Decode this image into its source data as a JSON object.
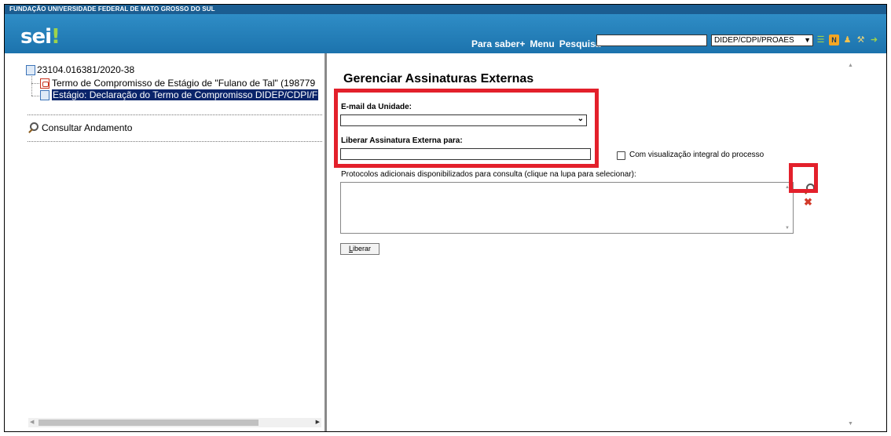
{
  "header": {
    "org_name": "FUNDAÇÃO UNIVERSIDADE FEDERAL DE MATO GROSSO DO SUL",
    "logo_text": "sei",
    "logo_mark": "!",
    "links": [
      "Para saber+",
      "Menu",
      "Pesquisa"
    ],
    "search_value": "",
    "unit_selected": "DIDEP/CDPI/PROAES",
    "icons": [
      "list-icon",
      "notification-icon",
      "user-icon",
      "tools-icon",
      "exit-icon"
    ]
  },
  "tree": {
    "process_number": "23104.016381/2020-38",
    "documents": [
      {
        "label": "Termo de Compromisso de Estágio de \"Fulano de Tal\" (198779",
        "icon": "pdf-icon"
      },
      {
        "label": "Estágio: Declaração do Termo de Compromisso DIDEP/CDPI/F",
        "icon": "document-icon",
        "selected": true
      }
    ],
    "consult_label": "Consultar Andamento"
  },
  "form": {
    "title": "Gerenciar Assinaturas Externas",
    "email_label": "E-mail da Unidade:",
    "email_value": "",
    "liberar_para_label": "Liberar Assinatura Externa para:",
    "liberar_para_value": "",
    "integral_label": "Com visualização integral do processo",
    "protocols_label": "Protocolos adicionais disponibilizados para consulta (clique na lupa para selecionar):",
    "submit_label_first": "L",
    "submit_label_rest": "iberar"
  },
  "colors": {
    "header_blue": "#1c73ad",
    "selection": "#0a246a",
    "annotation_red": "#e3202b"
  }
}
